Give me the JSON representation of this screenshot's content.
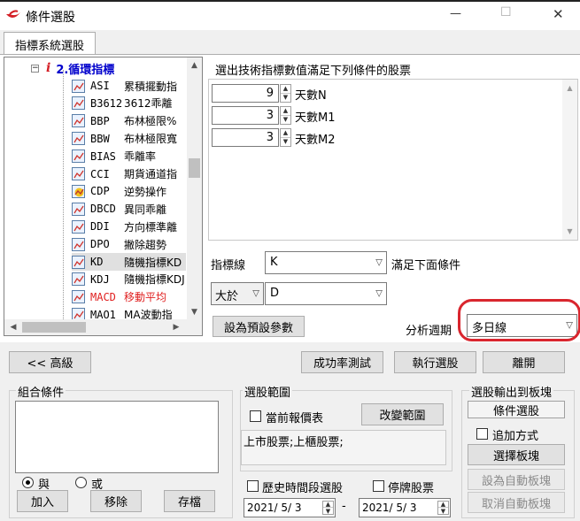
{
  "window": {
    "title": "條件選股",
    "controls": {
      "minimize": "—",
      "maximize": "☐",
      "close": "✕"
    }
  },
  "tab": {
    "label": "指標系統選股"
  },
  "tree": {
    "group_prefix": "i",
    "group_label": "2.循環指標",
    "items": [
      {
        "code": "ASI",
        "name": "累積擺動指"
      },
      {
        "code": "B3612",
        "name": "3612乖離"
      },
      {
        "code": "BBP",
        "name": "布林極限%"
      },
      {
        "code": "BBW",
        "name": "布林極限寬"
      },
      {
        "code": "BIAS",
        "name": "乖離率"
      },
      {
        "code": "CCI",
        "name": "期貨通道指"
      },
      {
        "code": "CDP",
        "name": "逆勢操作"
      },
      {
        "code": "DBCD",
        "name": "異同乖離"
      },
      {
        "code": "DDI",
        "name": "方向標準離"
      },
      {
        "code": "DPO",
        "name": "撇除趨勢"
      },
      {
        "code": "KD",
        "name": "隨機指標KD"
      },
      {
        "code": "KDJ",
        "name": "隨機指標KDJ"
      },
      {
        "code": "MACD",
        "name": "移動平均"
      },
      {
        "code": "MAO1",
        "name": "MA波動指"
      }
    ]
  },
  "main": {
    "description": "選出技術指標數值滿足下列條件的股票",
    "params": [
      {
        "value": "9",
        "label": "天數N"
      },
      {
        "value": "3",
        "label": "天數M1"
      },
      {
        "value": "3",
        "label": "天數M2"
      }
    ],
    "indicator_line_label": "指標線",
    "indicator_line_value": "K",
    "satisfy_label": "滿足下面條件",
    "comparator_value": "大於",
    "compare_target_value": "D",
    "set_default_button": "設為預設參數",
    "period_label": "分析週期",
    "period_value": "多日線"
  },
  "actions": {
    "advanced": "<< 高級",
    "success_rate": "成功率測試",
    "execute": "執行選股",
    "leave": "離開"
  },
  "combo_group": {
    "title": "組合條件",
    "and_label": "與",
    "or_label": "或",
    "add": "加入",
    "remove": "移除",
    "save": "存檔"
  },
  "range_group": {
    "title": "選股範圍",
    "current_quote_label": "當前報價表",
    "change_range_button": "改變範圍",
    "range_text": "上市股票;上櫃股票;",
    "history_label": "歷史時間段選股",
    "suspended_label": "停牌股票",
    "date_from": "2021/ 5/ 3",
    "date_sep": "-",
    "date_to": "2021/ 5/ 3"
  },
  "output_group": {
    "title": "選股輸出到板塊",
    "selected_block": "條件選股",
    "append_label": "追加方式",
    "choose_block": "選擇板塊",
    "set_auto_block": "設為自動板塊",
    "cancel_auto_block": "取消自動板塊"
  },
  "colors": {
    "highlight_ring": "#d9262e",
    "tree_group": "#0000cc",
    "tree_selected_row": "#e0e0e0"
  }
}
